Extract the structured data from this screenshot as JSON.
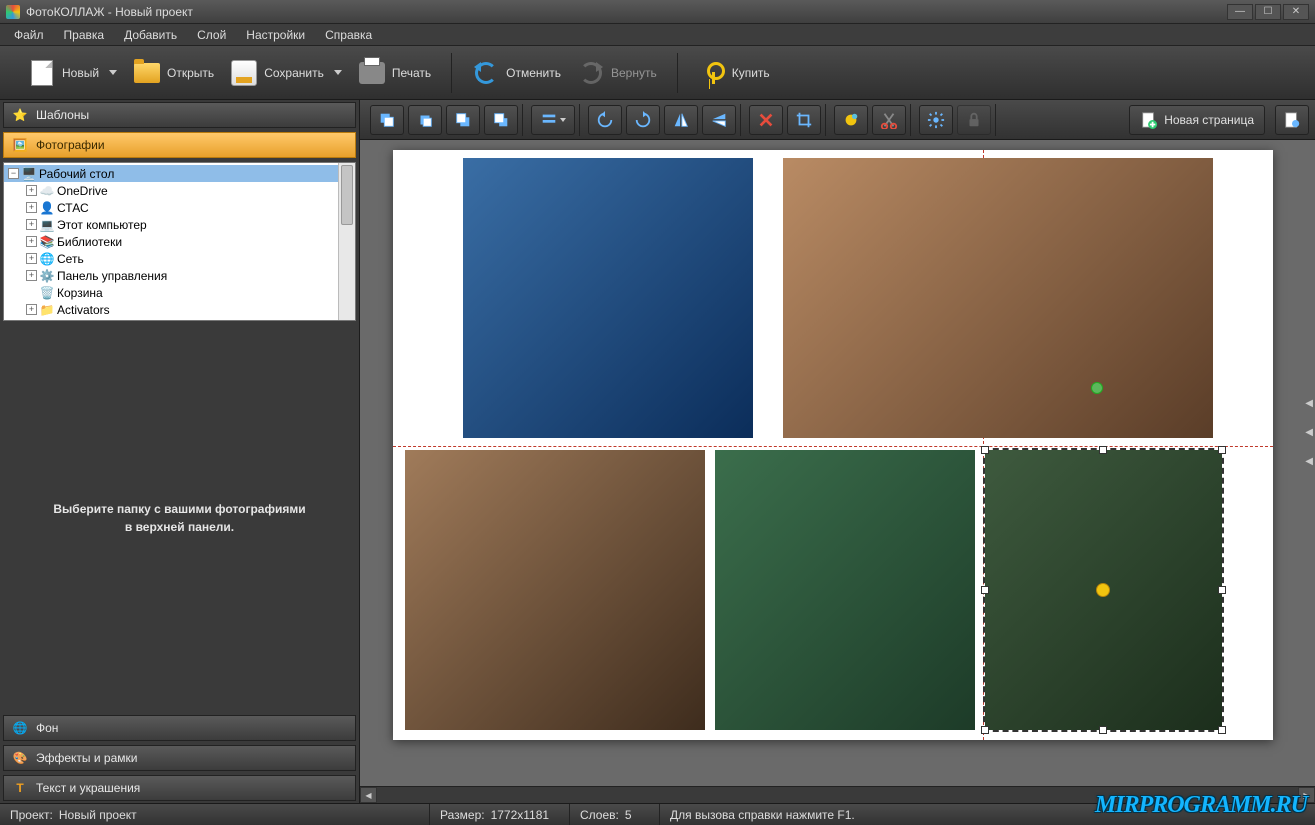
{
  "title": "ФотоКОЛЛАЖ - Новый проект",
  "menu": [
    "Файл",
    "Правка",
    "Добавить",
    "Слой",
    "Настройки",
    "Справка"
  ],
  "toolbar": {
    "new": "Новый",
    "open": "Открыть",
    "save": "Сохранить",
    "print": "Печать",
    "undo": "Отменить",
    "redo": "Вернуть",
    "buy": "Купить"
  },
  "sidebar": {
    "templates": "Шаблоны",
    "photos": "Фотографии",
    "background": "Фон",
    "effects": "Эффекты и рамки",
    "text": "Текст и украшения",
    "hint": "Выберите папку с вашими фотографиями в верхней панели."
  },
  "tree": [
    {
      "label": "Рабочий стол",
      "depth": 0,
      "expandable": true,
      "expanded": true,
      "selected": true,
      "icon": "desktop"
    },
    {
      "label": "OneDrive",
      "depth": 1,
      "expandable": true,
      "icon": "cloud"
    },
    {
      "label": "СТАС",
      "depth": 1,
      "expandable": true,
      "icon": "user"
    },
    {
      "label": "Этот компьютер",
      "depth": 1,
      "expandable": true,
      "icon": "pc"
    },
    {
      "label": "Библиотеки",
      "depth": 1,
      "expandable": true,
      "icon": "lib"
    },
    {
      "label": "Сеть",
      "depth": 1,
      "expandable": true,
      "icon": "net"
    },
    {
      "label": "Панель управления",
      "depth": 1,
      "expandable": true,
      "icon": "panel"
    },
    {
      "label": "Корзина",
      "depth": 1,
      "expandable": false,
      "icon": "bin"
    },
    {
      "label": "Activators",
      "depth": 1,
      "expandable": true,
      "icon": "folder"
    }
  ],
  "canvasToolbar": {
    "newPage": "Новая страница"
  },
  "status": {
    "projectKey": "Проект:",
    "projectVal": "Новый проект",
    "sizeKey": "Размер:",
    "sizeVal": "1772x1181",
    "layersKey": "Слоев:",
    "layersVal": "5",
    "help": "Для вызова справки нажмите F1."
  },
  "watermark": "MIRPROGRAMM.RU"
}
